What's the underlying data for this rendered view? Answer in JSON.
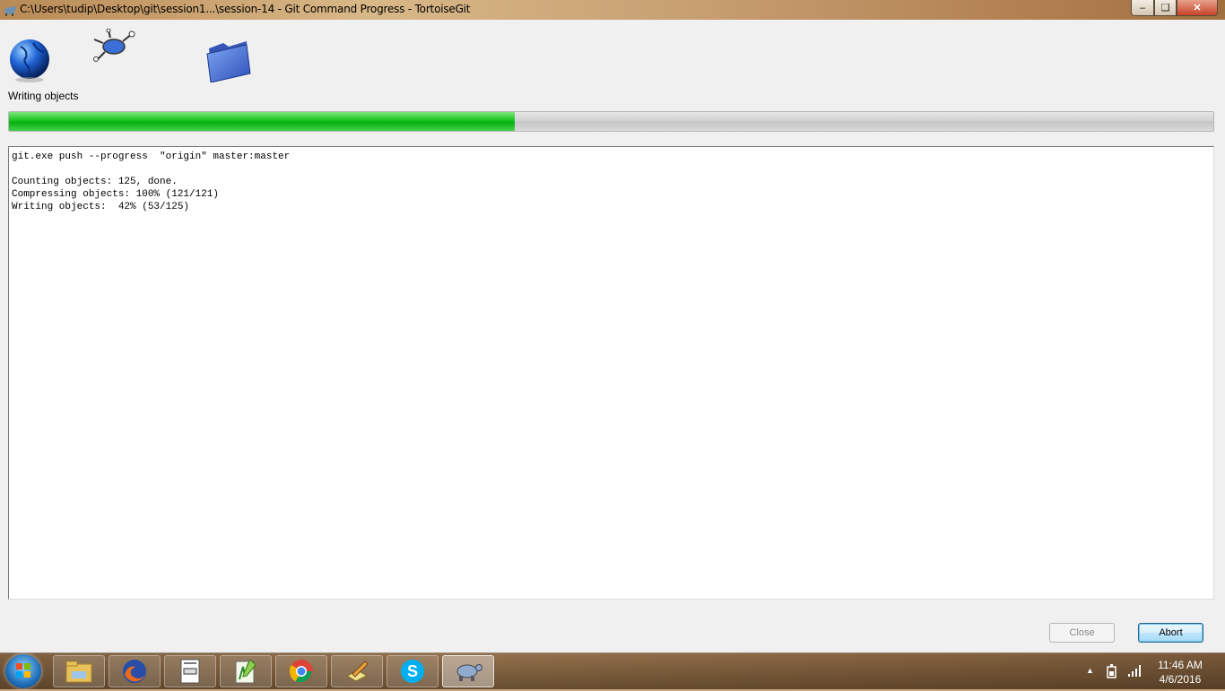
{
  "window": {
    "title": "C:\\Users\\tudip\\Desktop\\git\\session1...\\session-14 - Git Command Progress - TortoiseGit",
    "app_icon": "tortoisegit-icon",
    "controls": {
      "minimize": "minimize-icon",
      "maximize": "maximize-icon",
      "close": "close-icon"
    }
  },
  "animation": {
    "source_icon": "globe-icon",
    "moving_icon": "flying-tortoise-icon",
    "target_icon": "folder-icon"
  },
  "status": {
    "label": "Writing objects",
    "progress_fraction": 0.42
  },
  "log": {
    "lines": [
      "git.exe push --progress  \"origin\" master:master",
      "",
      "Counting objects: 125, done.",
      "Compressing objects: 100% (121/121)",
      "Writing objects:  42% (53/125)"
    ]
  },
  "buttons": {
    "close_label": "Close",
    "abort_label": "Abort"
  },
  "taskbar": {
    "start": "windows-start-icon",
    "apps": [
      "file-explorer-icon",
      "firefox-icon",
      "document-app-icon",
      "notepad-plus-plus-icon",
      "chrome-icon",
      "editor-pencil-icon",
      "skype-icon",
      "tortoisegit-icon"
    ],
    "active_app_index": 7,
    "tray_icons": [
      "show-hidden-icons-arrow-icon",
      "power-icon",
      "network-signal-icon"
    ],
    "clock": {
      "time": "11:46 AM",
      "date": "4/6/2016"
    }
  }
}
